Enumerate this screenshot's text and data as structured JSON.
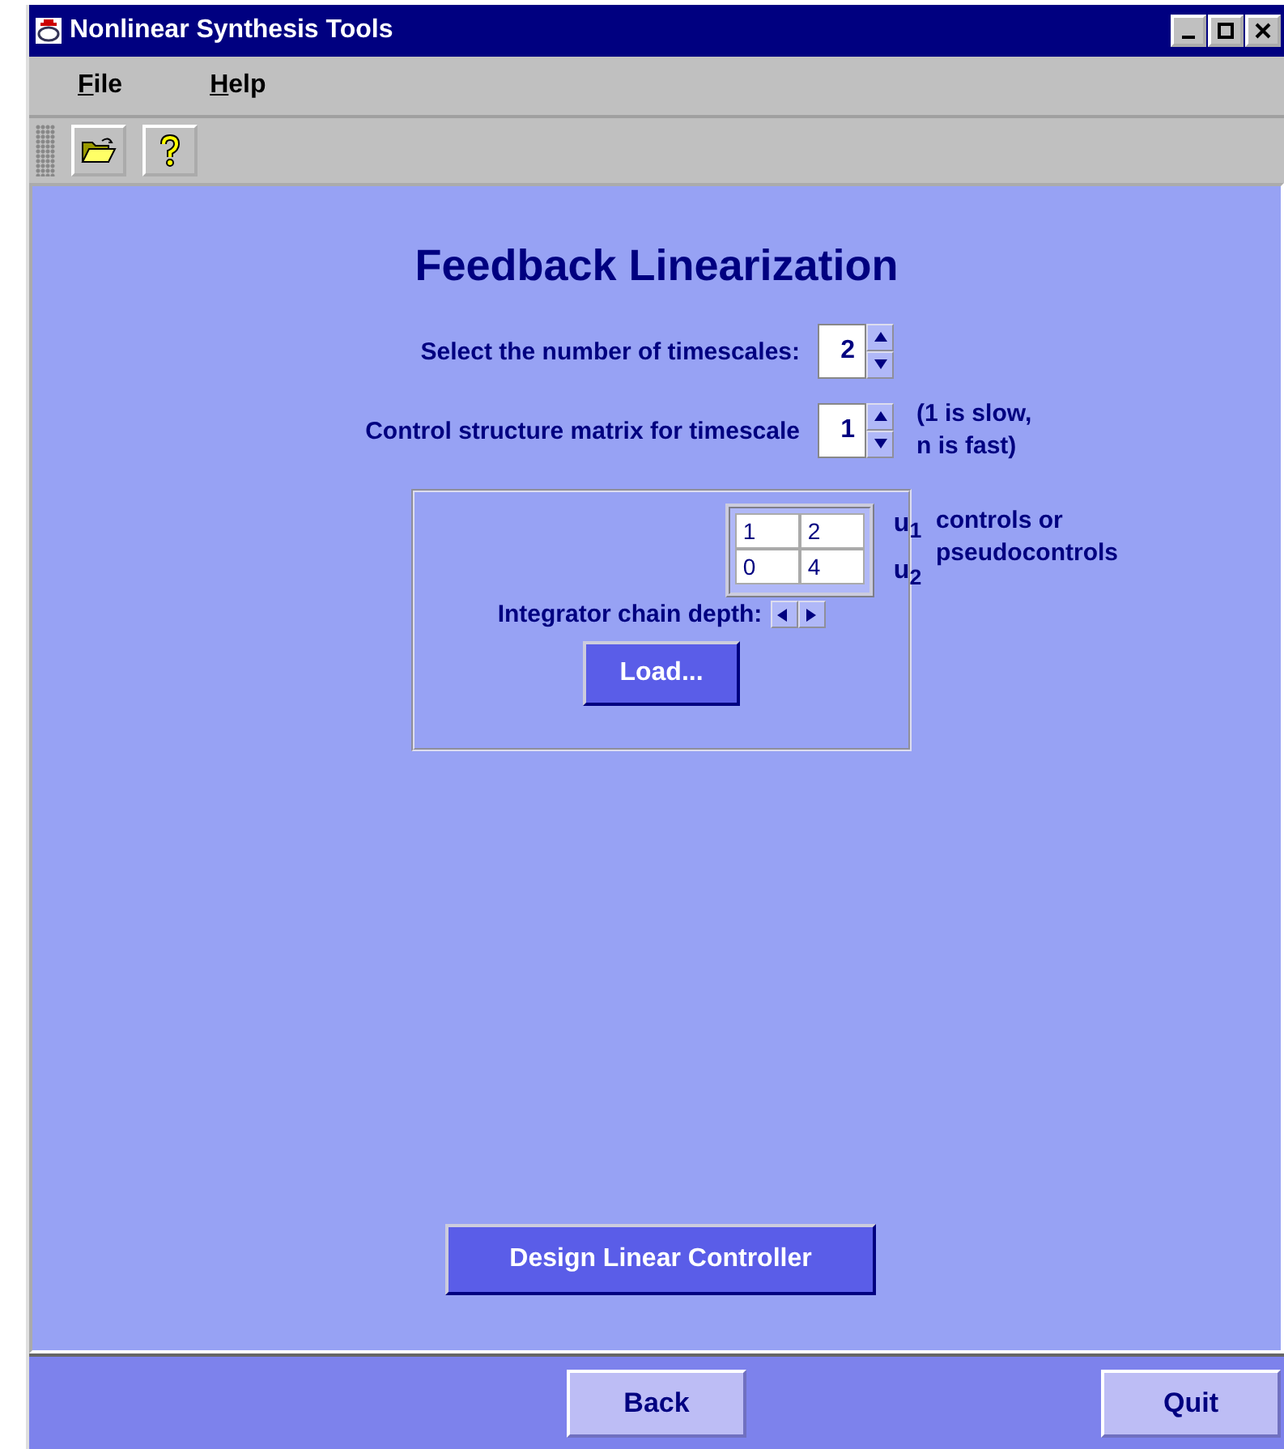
{
  "window": {
    "title": "Nonlinear Synthesis Tools"
  },
  "menu": [
    {
      "label": "File"
    },
    {
      "label": "Help"
    }
  ],
  "toolbar": [
    {
      "kind": "open"
    },
    {
      "kind": "help"
    }
  ],
  "heading": "Feedback Linearization",
  "timescales": {
    "label": "Select the number of timescales:",
    "value": "2"
  },
  "structure": {
    "label": "Control structure matrix for timescale",
    "value": "1",
    "note": "(1 is slow,\nn is fast)"
  },
  "matrix": {
    "rows": [
      [
        "1",
        "2"
      ],
      [
        "0",
        "4"
      ]
    ],
    "row_labels": [
      "u$_{1}$",
      "u$_{2}$"
    ],
    "note": "controls or\npseudocontrols"
  },
  "depth": {
    "label": "Integrator chain depth:"
  },
  "load_button": "Load...",
  "design_button": "Design Linear Controller",
  "footer": [
    "Back",
    "Quit"
  ]
}
